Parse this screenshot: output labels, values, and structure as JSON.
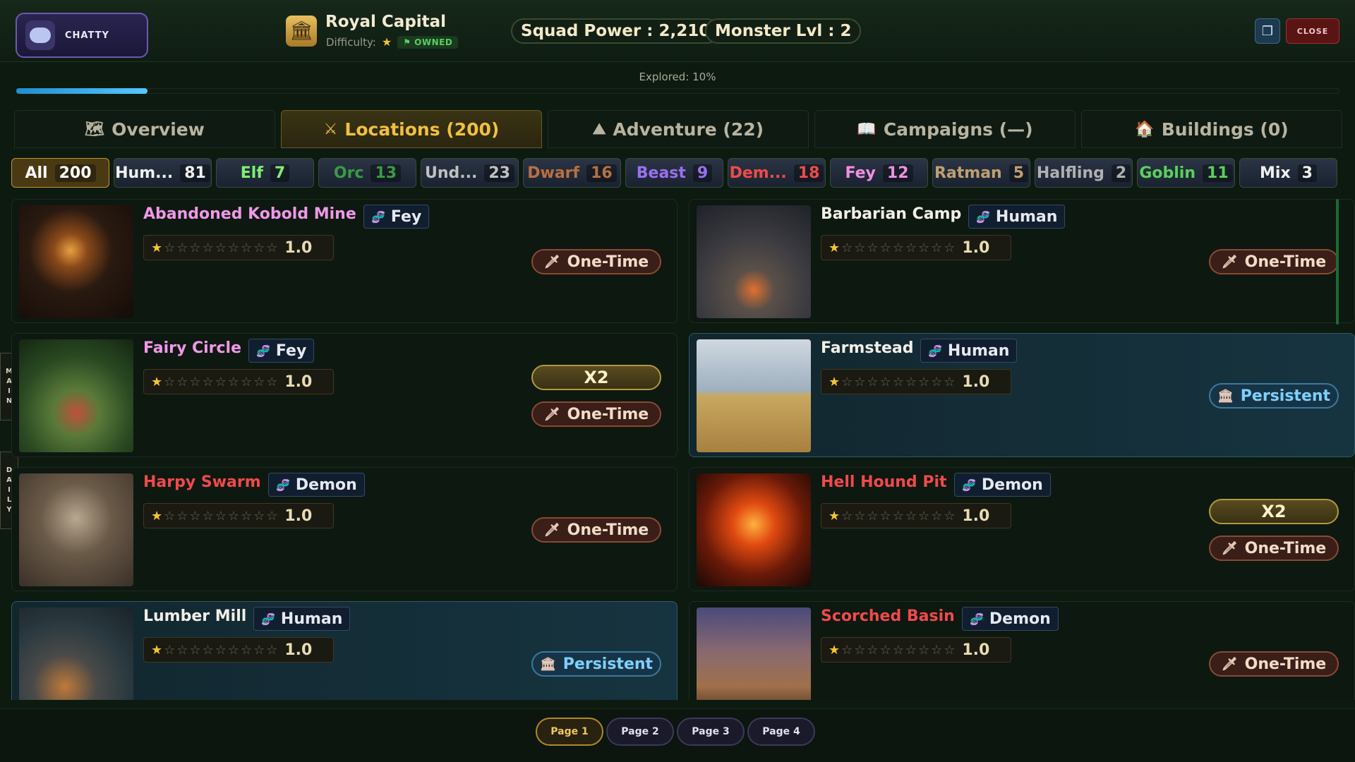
{
  "header": {
    "chat_label": "CHATTY",
    "location_name": "Royal Capital",
    "difficulty_label": "Difficulty:",
    "owned_label": "OWNED",
    "squad_power": "Squad Power : 2,210",
    "monster_level": "Monster Lvl : 2",
    "close_label": "CLOSE"
  },
  "progress": {
    "label": "Explored: 10%",
    "value": 0.1
  },
  "tabs": [
    {
      "label": "Overview",
      "icon": "map-icon"
    },
    {
      "label": "Locations (200)",
      "icon": "crossed-swords-icon"
    },
    {
      "label": "Adventure (22)",
      "icon": "mountain-icon"
    },
    {
      "label": "Campaigns (—)",
      "icon": "book-icon"
    },
    {
      "label": "Buildings (0)",
      "icon": "house-icon"
    }
  ],
  "active_tab": 1,
  "filters": [
    {
      "label": "All",
      "count": "200",
      "color": "#ffffff",
      "active": true
    },
    {
      "label": "Hum...",
      "count": "81",
      "color": "#f0f0f0"
    },
    {
      "label": "Elf",
      "count": "7",
      "color": "#7df070"
    },
    {
      "label": "Orc",
      "count": "13",
      "color": "#3a9a44"
    },
    {
      "label": "Und...",
      "count": "23",
      "color": "#c0c0c0"
    },
    {
      "label": "Dwarf",
      "count": "16",
      "color": "#b87040"
    },
    {
      "label": "Beast",
      "count": "9",
      "color": "#9a70f0"
    },
    {
      "label": "Dem...",
      "count": "18",
      "color": "#f04a4a"
    },
    {
      "label": "Fey",
      "count": "12",
      "color": "#f090e0"
    },
    {
      "label": "Ratman",
      "count": "5",
      "color": "#c0a070"
    },
    {
      "label": "Halfling",
      "count": "2",
      "color": "#b0b0b0"
    },
    {
      "label": "Goblin",
      "count": "11",
      "color": "#5ad05a"
    },
    {
      "label": "Mix",
      "count": "3",
      "color": "#f0f0f0"
    }
  ],
  "side_tabs": {
    "main": "MAIN",
    "daily": "DAILY"
  },
  "locations": [
    {
      "name": "Abandoned Kobold Mine",
      "race": "Fey",
      "name_color": "#f098e8",
      "rating": "1.0",
      "badges": [
        "One-Time"
      ]
    },
    {
      "name": "Barbarian Camp",
      "race": "Human",
      "name_color": "#f2efe6",
      "rating": "1.0",
      "badges": [
        "One-Time"
      ]
    },
    {
      "name": "Fairy Circle",
      "race": "Fey",
      "name_color": "#f098e8",
      "rating": "1.0",
      "badges": [
        "X2",
        "One-Time"
      ]
    },
    {
      "name": "Farmstead",
      "race": "Human",
      "name_color": "#f2efe6",
      "rating": "1.0",
      "badges": [
        "Persistent"
      ]
    },
    {
      "name": "Harpy Swarm",
      "race": "Demon",
      "name_color": "#f04a4a",
      "rating": "1.0",
      "badges": [
        "One-Time"
      ]
    },
    {
      "name": "Hell Hound Pit",
      "race": "Demon",
      "name_color": "#f04a4a",
      "rating": "1.0",
      "badges": [
        "X2",
        "One-Time"
      ]
    },
    {
      "name": "Lumber Mill",
      "race": "Human",
      "name_color": "#f2efe6",
      "rating": "1.0",
      "badges": [
        "Persistent"
      ]
    },
    {
      "name": "Scorched Basin",
      "race": "Demon",
      "name_color": "#f04a4a",
      "rating": "1.0",
      "badges": [
        "One-Time"
      ]
    }
  ],
  "pagination": {
    "pages": [
      "Page 1",
      "Page 2",
      "Page 3",
      "Page 4"
    ],
    "active": 0
  }
}
